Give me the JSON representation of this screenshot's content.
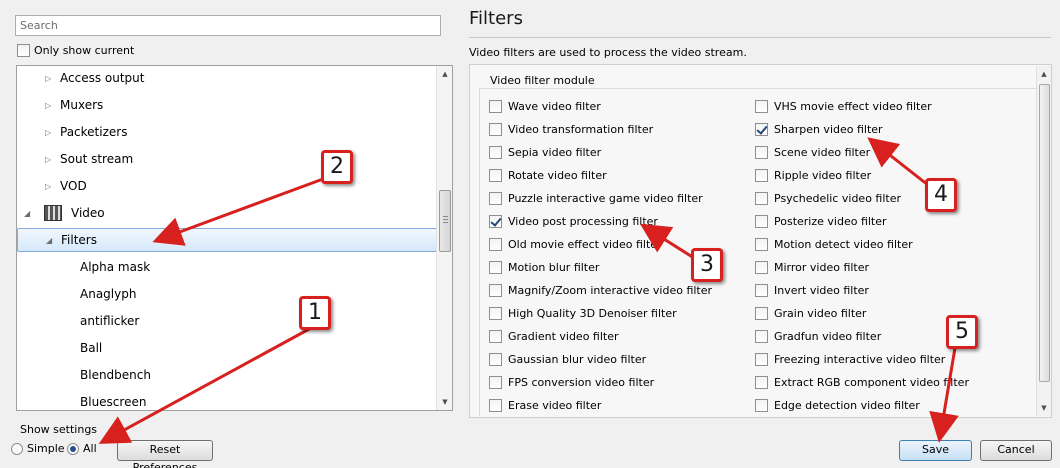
{
  "left_panel": {
    "search_placeholder": "Search",
    "only_show_current": "Only show current",
    "tree": [
      {
        "label": "Access output",
        "level": 1,
        "expander": "▷"
      },
      {
        "label": "Muxers",
        "level": 1,
        "expander": "▷"
      },
      {
        "label": "Packetizers",
        "level": 1,
        "expander": "▷"
      },
      {
        "label": "Sout stream",
        "level": 1,
        "expander": "▷"
      },
      {
        "label": "VOD",
        "level": 1,
        "expander": "▷"
      },
      {
        "label": "Video",
        "level": 0,
        "expander": "◢"
      },
      {
        "label": "Filters",
        "level": 1,
        "expander": "◢",
        "selected": true
      },
      {
        "label": "Alpha mask",
        "level": 2
      },
      {
        "label": "Anaglyph",
        "level": 2
      },
      {
        "label": "antiflicker",
        "level": 2
      },
      {
        "label": "Ball",
        "level": 2
      },
      {
        "label": "Blendbench",
        "level": 2
      },
      {
        "label": "Bluescreen",
        "level": 2
      }
    ],
    "show_settings": {
      "legend": "Show settings",
      "simple": "Simple",
      "all": "All",
      "selected": "All"
    },
    "reset_button": "Reset Preferences"
  },
  "right_panel": {
    "title": "Filters",
    "description": "Video filters are used to process the video stream.",
    "module_legend": "Video filter module",
    "filters_left": [
      {
        "label": "Wave video filter",
        "checked": false
      },
      {
        "label": "Video transformation filter",
        "checked": false
      },
      {
        "label": "Sepia video filter",
        "checked": false
      },
      {
        "label": "Rotate video filter",
        "checked": false
      },
      {
        "label": "Puzzle interactive game video filter",
        "checked": false
      },
      {
        "label": "Video post processing filter",
        "checked": true
      },
      {
        "label": "Old movie effect video filter",
        "checked": false
      },
      {
        "label": "Motion blur filter",
        "checked": false
      },
      {
        "label": "Magnify/Zoom interactive video filter",
        "checked": false
      },
      {
        "label": "High Quality 3D Denoiser filter",
        "checked": false
      },
      {
        "label": "Gradient video filter",
        "checked": false
      },
      {
        "label": "Gaussian blur video filter",
        "checked": false
      },
      {
        "label": "FPS conversion video filter",
        "checked": false
      },
      {
        "label": "Erase video filter",
        "checked": false
      }
    ],
    "filters_right": [
      {
        "label": "VHS movie effect video filter",
        "checked": false
      },
      {
        "label": "Sharpen video filter",
        "checked": true
      },
      {
        "label": "Scene video filter",
        "checked": false
      },
      {
        "label": "Ripple video filter",
        "checked": false
      },
      {
        "label": "Psychedelic video filter",
        "checked": false
      },
      {
        "label": "Posterize video filter",
        "checked": false
      },
      {
        "label": "Motion detect video filter",
        "checked": false
      },
      {
        "label": "Mirror video filter",
        "checked": false
      },
      {
        "label": "Invert video filter",
        "checked": false
      },
      {
        "label": "Grain video filter",
        "checked": false
      },
      {
        "label": "Gradfun video filter",
        "checked": false
      },
      {
        "label": "Freezing interactive video filter",
        "checked": false
      },
      {
        "label": "Extract RGB component video filter",
        "checked": false
      },
      {
        "label": "Edge detection video filter",
        "checked": false
      }
    ],
    "save_button": "Save",
    "cancel_button": "Cancel"
  },
  "annotations": {
    "markers": [
      "1",
      "2",
      "3",
      "4",
      "5"
    ],
    "color": "#d8201f"
  }
}
